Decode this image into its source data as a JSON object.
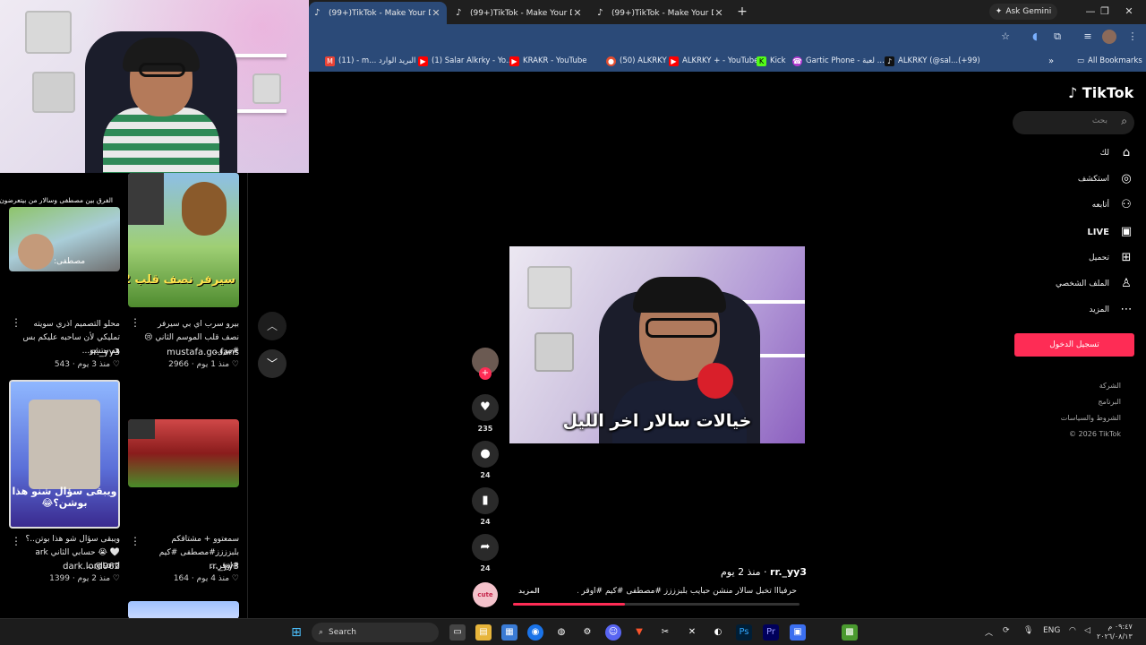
{
  "browser": {
    "tabs": [
      {
        "label": "(99+)TikTok - Make Your Day"
      },
      {
        "label": "(99+)TikTok - Make Your Day"
      },
      {
        "label": "(99+)TikTok - Make Your Day"
      }
    ],
    "ask_gemini": "Ask Gemini",
    "bookmarks": [
      {
        "label": "(11) - m... البريد الوارد",
        "color": "#ea4335",
        "icon": "gmail-icon"
      },
      {
        "label": "(1) Salar Alkrky - Yo...",
        "color": "#ff0000",
        "icon": "youtube-icon"
      },
      {
        "label": "KRAKR - YouTube",
        "color": "#ff0000",
        "icon": "youtube-icon"
      },
      {
        "label": "(50) ALKRKY",
        "color": "#e34d2f",
        "icon": "reddit-icon"
      },
      {
        "label": "ALKRKY + - YouTube",
        "color": "#ff0000",
        "icon": "youtube-icon"
      },
      {
        "label": "Kick",
        "color": "#53fc18",
        "icon": "kick-icon"
      },
      {
        "label": "Gartic Phone - لعبة ...",
        "color": "#b23bd1",
        "icon": "gartic-icon"
      },
      {
        "label": "ALKRKY (@sal...(+99)",
        "color": "#111111",
        "icon": "tiktok-icon"
      }
    ],
    "all_bookmarks": "All Bookmarks"
  },
  "feed": {
    "cards": [
      {
        "overlay": "الفرق بين مصطفى وسالار من بيتعرضون:",
        "thumb_caption": "مصطفى:",
        "title": "محلو التصميم اذري سويته تمليكي لأن ساحبه عليكم بس هم متشو...",
        "author": "rr._yy3",
        "likes": "543",
        "age": "منذ 3 يوم"
      },
      {
        "overlay": "",
        "thumb_caption": "سيرفر نصف قلب 2",
        "title": "بيرو سرب اي بي سيرفر نصف قلب الموسم الثاني 😢 #بيرو...",
        "author": "mustafa.go.fans",
        "likes": "2966",
        "age": "منذ 1 يوم"
      },
      {
        "overlay": "",
        "thumb_caption": "ويبقى سؤال شنو هذا بوشن؟😂",
        "title": "ويبقى سؤال شو هذا بوتن..؟🤍 😭 حسابي الثاني ark Lord@...",
        "author": "dark.lord962",
        "likes": "1399",
        "age": "منذ 2 يوم"
      },
      {
        "overlay": "",
        "thumb_caption": "",
        "title": "سمعتوو + مشتاقكم بلبزززز#مصطفى #كيم #اوقر...",
        "author": "rr._yy3",
        "likes": "164",
        "age": "منذ 4 يوم"
      }
    ]
  },
  "video": {
    "caption": "خيالات سالار اخر الليل",
    "author": "rr._yy3",
    "age": "منذ 2 يوم",
    "description": "حرفيااا تخبل سالار  منشن حبايب بلبزززز #مصطفى #كيم #اوقر ...",
    "more": "المزيد",
    "progress": 0.39,
    "likes": "235",
    "comments": "24",
    "saves": "24",
    "shares": "24",
    "music_label": "cute"
  },
  "tiktok": {
    "logo": "TikTok",
    "search_placeholder": "بحث",
    "nav": [
      {
        "label": "لك",
        "icon": "home-icon"
      },
      {
        "label": "استكشف",
        "icon": "compass-icon"
      },
      {
        "label": "أتابعه",
        "icon": "following-icon"
      },
      {
        "label": "LIVE",
        "icon": "live-icon"
      },
      {
        "label": "تحميل",
        "icon": "upload-icon"
      },
      {
        "label": "الملف الشخصي",
        "icon": "profile-icon"
      },
      {
        "label": "المزيد",
        "icon": "more-icon"
      }
    ],
    "login": "تسجيل الدخول",
    "footer": [
      "الشركة",
      "البرنامج",
      "الشروط والسياسات",
      "© 2026 TikTok"
    ],
    "accent": "#fe2c55"
  },
  "taskbar": {
    "search_label": "Search",
    "lang": "ENG",
    "time": "٠٩:٤٧ م",
    "date": "٢٠٢٦/٠٨/١٣"
  }
}
